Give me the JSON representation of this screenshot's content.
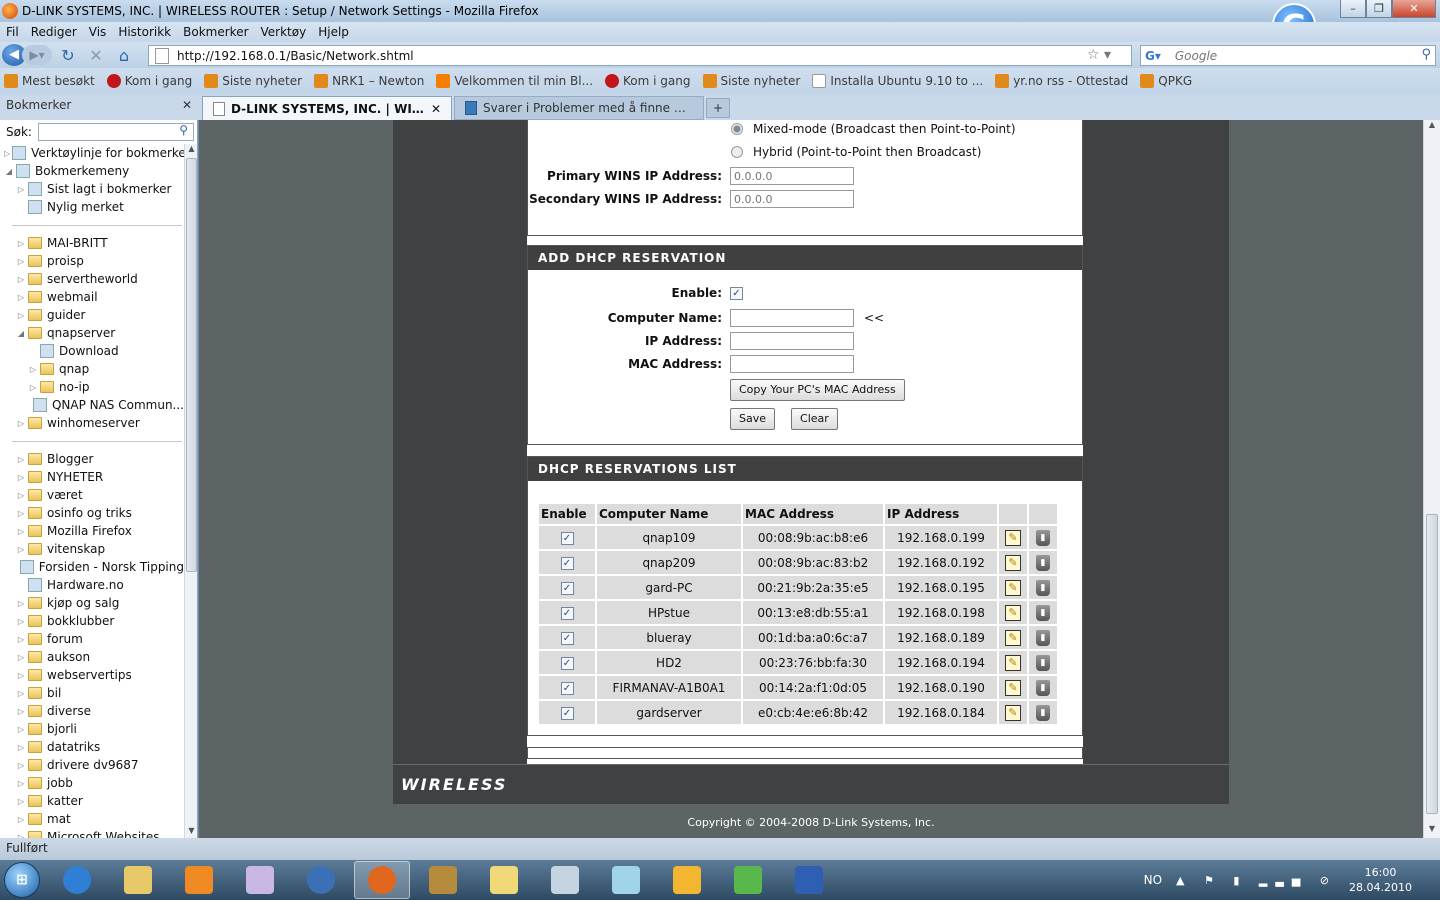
{
  "window": {
    "title": "D-LINK SYSTEMS, INC. | WIRELESS ROUTER : Setup / Network Settings - Mozilla Firefox",
    "min": "–",
    "max": "❐",
    "close": "✕",
    "g_badge": "G"
  },
  "menu": [
    "Fil",
    "Rediger",
    "Vis",
    "Historikk",
    "Bokmerker",
    "Verktøy",
    "Hjelp"
  ],
  "nav": {
    "back": "◀",
    "forward": "▶▾",
    "reload": "↻",
    "stop": "✕",
    "home": "⌂",
    "url": "http://192.168.0.1/Basic/Network.shtml",
    "star": "☆ ▾",
    "search_engine": "G▾",
    "search_placeholder": "Google",
    "search_icon": "⚲"
  },
  "bookmarks_toolbar": [
    {
      "label": "Mest besøkt",
      "icon": "rss"
    },
    {
      "label": "Kom i gang",
      "icon": "firefox"
    },
    {
      "label": "Siste nyheter",
      "icon": "rss"
    },
    {
      "label": "NRK1 – Newton",
      "icon": "rss"
    },
    {
      "label": "Velkommen til min Bl...",
      "icon": "blogger"
    },
    {
      "label": "Kom i gang",
      "icon": "firefox"
    },
    {
      "label": "Siste nyheter",
      "icon": "rss"
    },
    {
      "label": "Installa Ubuntu 9.10 to ...",
      "icon": "ubuntu"
    },
    {
      "label": "yr.no rss - Ottestad",
      "icon": "rss"
    },
    {
      "label": "QPKG",
      "icon": "rss"
    }
  ],
  "sidebar": {
    "title": "Bokmerker",
    "close": "✕",
    "search_label": "Søk:",
    "search_icon": "⚲",
    "scroll_up": "▲",
    "scroll_down": "▼",
    "items": [
      {
        "label": "Verktøylinje for bokmerker",
        "type": "bm",
        "indent": 0,
        "arrow": "▷"
      },
      {
        "label": "Bokmerkemeny",
        "type": "bm",
        "indent": 0,
        "arrow": "◢"
      },
      {
        "label": "Sist lagt i bokmerker",
        "type": "bm",
        "indent": 1,
        "arrow": "▷"
      },
      {
        "label": "Nylig merket",
        "type": "bm",
        "indent": 1,
        "arrow": ""
      },
      {
        "type": "sep"
      },
      {
        "label": "MAI-BRITT",
        "type": "folder",
        "indent": 1,
        "arrow": "▷"
      },
      {
        "label": "proisp",
        "type": "folder",
        "indent": 1,
        "arrow": "▷"
      },
      {
        "label": "servertheworld",
        "type": "folder",
        "indent": 1,
        "arrow": "▷"
      },
      {
        "label": "webmail",
        "type": "folder",
        "indent": 1,
        "arrow": "▷"
      },
      {
        "label": "guider",
        "type": "folder",
        "indent": 1,
        "arrow": "▷"
      },
      {
        "label": "qnapserver",
        "type": "folder",
        "indent": 1,
        "arrow": "◢"
      },
      {
        "label": "Download",
        "type": "bm",
        "indent": 2,
        "arrow": ""
      },
      {
        "label": "qnap",
        "type": "folder",
        "indent": 2,
        "arrow": "▷"
      },
      {
        "label": "no-ip",
        "type": "folder",
        "indent": 2,
        "arrow": "▷"
      },
      {
        "label": "QNAP NAS Commun...",
        "type": "bm",
        "indent": 2,
        "arrow": ""
      },
      {
        "label": "winhomeserver",
        "type": "folder",
        "indent": 1,
        "arrow": "▷"
      },
      {
        "type": "sep"
      },
      {
        "label": "Blogger",
        "type": "folder",
        "indent": 1,
        "arrow": "▷"
      },
      {
        "label": "NYHETER",
        "type": "folder",
        "indent": 1,
        "arrow": "▷"
      },
      {
        "label": "været",
        "type": "folder",
        "indent": 1,
        "arrow": "▷"
      },
      {
        "label": "osinfo og triks",
        "type": "folder",
        "indent": 1,
        "arrow": "▷"
      },
      {
        "label": "Mozilla Firefox",
        "type": "folder",
        "indent": 1,
        "arrow": "▷"
      },
      {
        "label": "vitenskap",
        "type": "folder",
        "indent": 1,
        "arrow": "▷"
      },
      {
        "label": "Forsiden - Norsk Tipping",
        "type": "bm",
        "indent": 1,
        "arrow": ""
      },
      {
        "label": "Hardware.no",
        "type": "bm",
        "indent": 1,
        "arrow": ""
      },
      {
        "label": "kjøp og salg",
        "type": "folder",
        "indent": 1,
        "arrow": "▷"
      },
      {
        "label": "bokklubber",
        "type": "folder",
        "indent": 1,
        "arrow": "▷"
      },
      {
        "label": "forum",
        "type": "folder",
        "indent": 1,
        "arrow": "▷"
      },
      {
        "label": "aukson",
        "type": "folder",
        "indent": 1,
        "arrow": "▷"
      },
      {
        "label": "webservertips",
        "type": "folder",
        "indent": 1,
        "arrow": "▷"
      },
      {
        "label": "bil",
        "type": "folder",
        "indent": 1,
        "arrow": "▷"
      },
      {
        "label": "diverse",
        "type": "folder",
        "indent": 1,
        "arrow": "▷"
      },
      {
        "label": "bjorli",
        "type": "folder",
        "indent": 1,
        "arrow": "▷"
      },
      {
        "label": "datatriks",
        "type": "folder",
        "indent": 1,
        "arrow": "▷"
      },
      {
        "label": "drivere dv9687",
        "type": "folder",
        "indent": 1,
        "arrow": "▷"
      },
      {
        "label": "jobb",
        "type": "folder",
        "indent": 1,
        "arrow": "▷"
      },
      {
        "label": "katter",
        "type": "folder",
        "indent": 1,
        "arrow": "▷"
      },
      {
        "label": "mat",
        "type": "folder",
        "indent": 1,
        "arrow": "▷"
      },
      {
        "label": "Microsoft Websites",
        "type": "folder",
        "indent": 1,
        "arrow": "▷"
      }
    ]
  },
  "tabs": [
    {
      "label": "D-LINK SYSTEMS, INC. | WIRELES...",
      "close": "✕"
    },
    {
      "label": "Svarer i Problemer med å finne Zyxe...",
      "close": ""
    }
  ],
  "new_tab": "+",
  "wins": {
    "partial_label": "(...)",
    "mixed_label": "Mixed-mode (Broadcast then Point-to-Point)",
    "hybrid_label": "Hybrid (Point-to-Point then Broadcast)",
    "primary_label": "Primary WINS IP Address:",
    "primary_value": "0.0.0.0",
    "secondary_label": "Secondary WINS IP Address:",
    "secondary_value": "0.0.0.0"
  },
  "add_reservation": {
    "title": "ADD DHCP RESERVATION",
    "enable_label": "Enable:",
    "enable_check": "✓",
    "computer_name_label": "Computer Name:",
    "computer_name_value": "",
    "arrow": "<<",
    "ip_label": "IP Address:",
    "ip_value": "",
    "mac_label": "MAC Address:",
    "mac_value": "",
    "copy_mac_button": "Copy Your PC's MAC Address",
    "save_button": "Save",
    "clear_button": "Clear"
  },
  "reservations_list": {
    "title": "DHCP RESERVATIONS LIST",
    "columns": [
      "Enable",
      "Computer Name",
      "MAC Address",
      "IP Address",
      "",
      ""
    ],
    "check": "✓",
    "edit_icon": "✎",
    "delete_icon": "▮",
    "rows": [
      {
        "name": "qnap109",
        "mac": "00:08:9b:ac:b8:e6",
        "ip": "192.168.0.199"
      },
      {
        "name": "qnap209",
        "mac": "00:08:9b:ac:83:b2",
        "ip": "192.168.0.192"
      },
      {
        "name": "gard-PC",
        "mac": "00:21:9b:2a:35:e5",
        "ip": "192.168.0.195"
      },
      {
        "name": "HPstue",
        "mac": "00:13:e8:db:55:a1",
        "ip": "192.168.0.198"
      },
      {
        "name": "blueray",
        "mac": "00:1d:ba:a0:6c:a7",
        "ip": "192.168.0.189"
      },
      {
        "name": "HD2",
        "mac": "00:23:76:bb:fa:30",
        "ip": "192.168.0.194"
      },
      {
        "name": "FIRMANAV-A1B0A1",
        "mac": "00:14:2a:f1:0d:05",
        "ip": "192.168.0.190"
      },
      {
        "name": "gardserver",
        "mac": "e0:cb:4e:e6:8b:42",
        "ip": "192.168.0.184"
      }
    ]
  },
  "footer": {
    "brand": "WIRELESS",
    "copyright": "Copyright © 2004-2008 D-Link Systems, Inc."
  },
  "page_scroll": {
    "up": "▲",
    "down": "▼"
  },
  "status": "Fullført",
  "taskbar": {
    "start": "⊞",
    "apps": [
      {
        "name": "internet-explorer",
        "color": "#2f7fd6"
      },
      {
        "name": "file-explorer",
        "color": "#e8c96a"
      },
      {
        "name": "media-player",
        "color": "#f08a24"
      },
      {
        "name": "paint",
        "color": "#c9b7e6"
      },
      {
        "name": "thunderbird",
        "color": "#3b6fb6"
      },
      {
        "name": "firefox",
        "color": "#e0671d"
      },
      {
        "name": "archive",
        "color": "#b58b3e"
      },
      {
        "name": "folder",
        "color": "#f1d97a"
      },
      {
        "name": "calculator",
        "color": "#c6d3e0"
      },
      {
        "name": "notes",
        "color": "#9fd4ea"
      },
      {
        "name": "outlook",
        "color": "#f2b630"
      },
      {
        "name": "messenger",
        "color": "#58b84b"
      },
      {
        "name": "word",
        "color": "#2f5fb3"
      }
    ],
    "lang": "NO",
    "tray": "▲ ⚑ ▮ ▂▃▅ ⊘",
    "time": "16:00",
    "date": "28.04.2010"
  }
}
